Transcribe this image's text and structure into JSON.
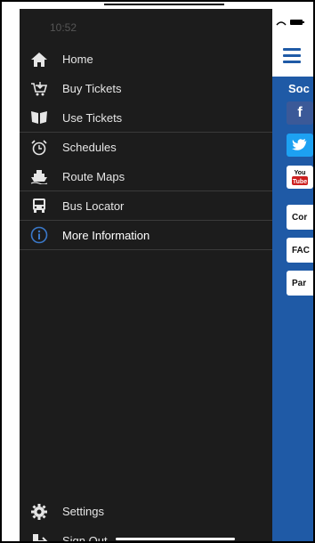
{
  "status": {
    "time": "10:52"
  },
  "menu": {
    "items": [
      {
        "label": "Home",
        "icon": "house-icon"
      },
      {
        "label": "Buy Tickets",
        "icon": "cart-icon"
      },
      {
        "label": "Use Tickets",
        "icon": "ticket-icon"
      },
      {
        "label": "Schedules",
        "icon": "alarm-clock-icon"
      },
      {
        "label": "Route Maps",
        "icon": "ferry-icon"
      },
      {
        "label": "Bus Locator",
        "icon": "bus-icon"
      },
      {
        "label": "More Information",
        "icon": "info-icon"
      }
    ],
    "bottom": [
      {
        "label": "Settings",
        "icon": "gear-icon"
      },
      {
        "label": "Sign Out",
        "icon": "sign-out-icon"
      }
    ]
  },
  "content": {
    "section_title": "Soc",
    "youtube_label": "You Tube",
    "cards": [
      "Cor",
      "FAC",
      "Par"
    ]
  },
  "colors": {
    "drawer_bg": "#1c1c1c",
    "accent_blue": "#1f5aa6",
    "facebook": "#3b5998",
    "twitter": "#1da1f2"
  }
}
